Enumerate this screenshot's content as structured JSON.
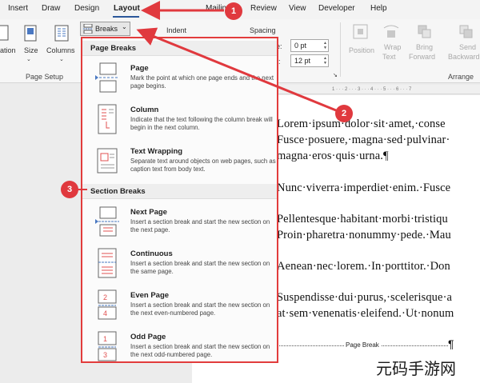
{
  "tabs": [
    "Insert",
    "Draw",
    "Design",
    "Layout",
    "Mailings",
    "Review",
    "View",
    "Developer",
    "Help"
  ],
  "active_tab": "Layout",
  "ribbon": {
    "left_buttons": [
      "ation",
      "Size",
      "Columns"
    ],
    "breaks_label": "Breaks",
    "indent_label": "Indent",
    "spacing_label": "Spacing",
    "before_prefix": "e:",
    "before_value": "0 pt",
    "after_prefix": "r:",
    "after_value": "12 pt",
    "page_setup_label": "Page Setup",
    "position_label": "Position",
    "wrap_text_label_1": "Wrap",
    "wrap_text_label_2": "Text",
    "bring_forward_label_1": "Bring",
    "bring_forward_label_2": "Forward",
    "send_backward_label_1": "Send",
    "send_backward_label_2": "Backward",
    "arrange_label": "Arrange"
  },
  "breaks_menu": {
    "page_breaks_header": "Page Breaks",
    "section_breaks_header": "Section Breaks",
    "items": [
      {
        "title": "Page",
        "desc": "Mark the point at which one page ends and the next page begins."
      },
      {
        "title": "Column",
        "desc": "Indicate that the text following the column break will begin in the next column."
      },
      {
        "title": "Text Wrapping",
        "desc": "Separate text around objects on web pages, such as caption text from body text."
      },
      {
        "title": "Next Page",
        "desc": "Insert a section break and start the new section on the next page."
      },
      {
        "title": "Continuous",
        "desc": "Insert a section break and start the new section on the same page."
      },
      {
        "title": "Even Page",
        "desc": "Insert a section break and start the new section on the next even-numbered page."
      },
      {
        "title": "Odd Page",
        "desc": "Insert a section break and start the new section on the next odd-numbered page."
      }
    ]
  },
  "document": {
    "lines": [
      "Lorem·ipsum·dolor·sit·amet,·conse",
      "Fusce·posuere,·magna·sed·pulvinar·",
      "magna·eros·quis·urna.¶",
      "Nunc·viverra·imperdiet·enim.·Fusce",
      "Pellentesque·habitant·morbi·tristiqu",
      "Proin·pharetra·nonummy·pede.·Mau",
      "Aenean·nec·lorem.·In·porttitor.·Don",
      "Suspendisse·dui·purus,·scelerisque·a",
      "at·sem·venenatis·eleifend.·Ut·nonum"
    ],
    "page_break_label": "Page Break",
    "pilcrow": "¶"
  },
  "annotations": {
    "badge_1": "1",
    "badge_2": "2",
    "badge_3": "3",
    "color": "#e0393e"
  },
  "watermark": "元码手游网"
}
